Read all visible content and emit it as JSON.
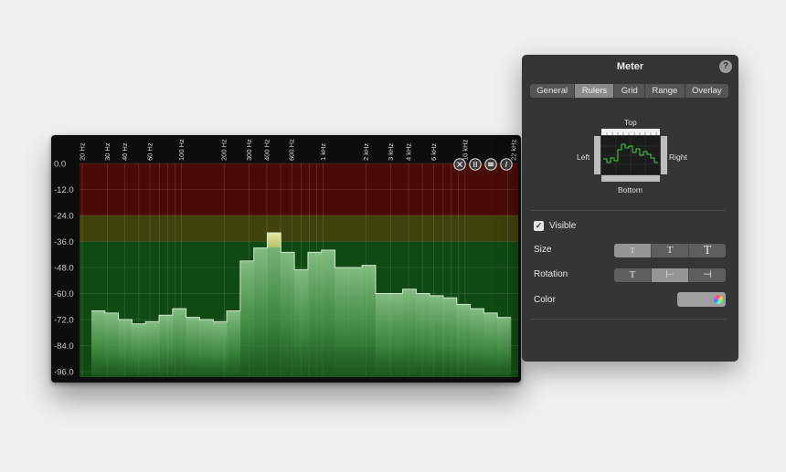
{
  "meter": {
    "freq_labels": [
      "20 Hz",
      "30 Hz",
      "40 Hz",
      "60 Hz",
      "100 Hz",
      "200 Hz",
      "300 Hz",
      "400 Hz",
      "600 Hz",
      "1 kHz",
      "2 kHz",
      "3 kHz",
      "4 kHz",
      "6 kHz",
      "10 kHz",
      "22 kHz"
    ],
    "db_labels": [
      "0.0",
      "-12.0",
      "-24.0",
      "-36.0",
      "-48.0",
      "-60.0",
      "-72.0",
      "-84.0",
      "-96.0"
    ],
    "spectrum_db": [
      -68,
      -69,
      -72,
      -74,
      -73,
      -70,
      -67,
      -71,
      -72,
      -73,
      -68,
      -45,
      -39,
      -32,
      -41,
      -49,
      -41,
      -40,
      -48,
      -48,
      -47,
      -60,
      -60,
      -58,
      -60,
      -61,
      -62,
      -65,
      -67,
      -69,
      -71
    ],
    "peak_band_index": 13,
    "zones": {
      "red": "#4a0b07",
      "yellow": "#3f420a",
      "green": "#0f4a12"
    },
    "controls": [
      "close-icon",
      "pause-icon",
      "menu-icon",
      "info-icon"
    ]
  },
  "panel": {
    "title": "Meter",
    "help": "?",
    "tabs": [
      "General",
      "Rulers",
      "Grid",
      "Range",
      "Overlay"
    ],
    "active_tab": "Rulers",
    "ruler_labels": {
      "top": "Top",
      "left": "Left",
      "right": "Right",
      "bottom": "Bottom"
    },
    "visible_label": "Visible",
    "visible_checked": "✓",
    "size_label": "Size",
    "size_options": [
      "T",
      "T",
      "T"
    ],
    "rotation_label": "Rotation",
    "rotation_options": [
      "T",
      "⊢",
      "⊣"
    ],
    "color_label": "Color",
    "accent": "#3c9b3c"
  }
}
